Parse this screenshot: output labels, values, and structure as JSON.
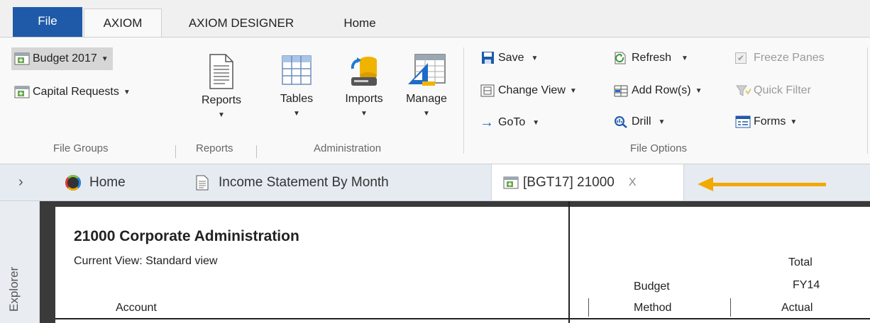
{
  "ribbon_tabs": {
    "file": "File",
    "items": [
      "AXIOM",
      "AXIOM DESIGNER",
      "Home"
    ]
  },
  "ribbon": {
    "file_groups": {
      "budget_2017": "Budget 2017",
      "capital_requests": "Capital Requests",
      "label": "File Groups"
    },
    "reports": {
      "button": "Reports",
      "label": "Reports"
    },
    "administration": {
      "tables": "Tables",
      "imports": "Imports",
      "manage": "Manage",
      "label": "Administration"
    },
    "file_options": {
      "save": "Save",
      "change_view": "Change View",
      "goto": "GoTo",
      "refresh": "Refresh",
      "add_rows": "Add Row(s)",
      "drill": "Drill",
      "freeze_panes": "Freeze Panes",
      "quick_filter": "Quick Filter",
      "forms": "Forms",
      "label": "File Options"
    }
  },
  "doc_tabs": {
    "expand": "›",
    "home": "Home",
    "income_statement": "Income Statement By Month",
    "active": "[BGT17] 21000",
    "close": "X"
  },
  "explorer": {
    "label": "Explorer"
  },
  "sheet": {
    "title": "21000 Corporate Administration",
    "current_view": "Current View:  Standard view",
    "account_header": "Account",
    "budget_header": "Budget",
    "method_header": "Method",
    "total_header": "Total",
    "fy14_header": "FY14",
    "actual_header": "Actual"
  },
  "colors": {
    "accent": "#1e5aa8",
    "arrow": "#f2a900"
  }
}
